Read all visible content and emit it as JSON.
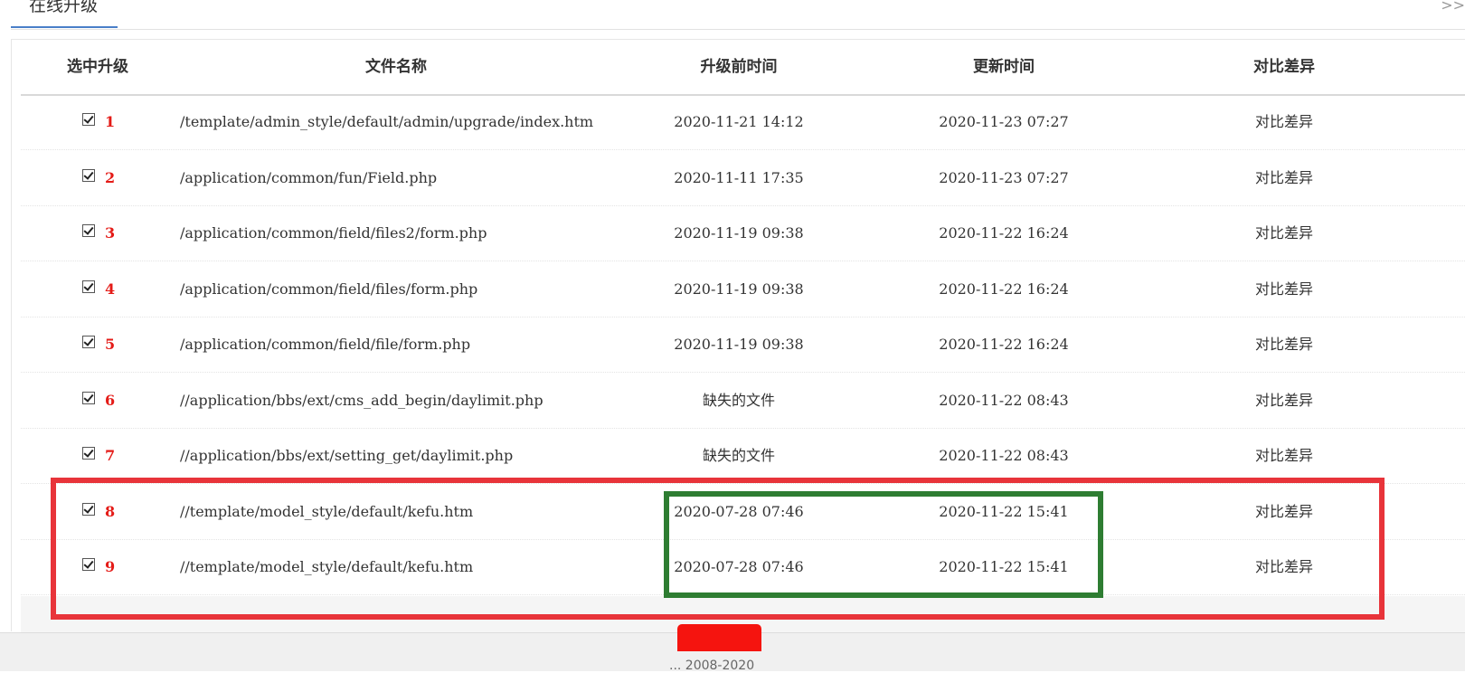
{
  "tab": {
    "title": "在线升级",
    "more": ">>"
  },
  "table": {
    "headers": {
      "select": "选中升级",
      "filename": "文件名称",
      "before_time": "升级前时间",
      "update_time": "更新时间",
      "diff": "对比差异"
    },
    "rows": [
      {
        "num": "1",
        "checked": true,
        "file": "/template/admin_style/default/admin/upgrade/index.htm",
        "before": "2020-11-21 14:12",
        "update": "2020-11-23 07:27",
        "diff": "对比差异"
      },
      {
        "num": "2",
        "checked": true,
        "file": "/application/common/fun/Field.php",
        "before": "2020-11-11 17:35",
        "update": "2020-11-23 07:27",
        "diff": "对比差异"
      },
      {
        "num": "3",
        "checked": true,
        "file": "/application/common/field/files2/form.php",
        "before": "2020-11-19 09:38",
        "update": "2020-11-22 16:24",
        "diff": "对比差异"
      },
      {
        "num": "4",
        "checked": true,
        "file": "/application/common/field/files/form.php",
        "before": "2020-11-19 09:38",
        "update": "2020-11-22 16:24",
        "diff": "对比差异"
      },
      {
        "num": "5",
        "checked": true,
        "file": "/application/common/field/file/form.php",
        "before": "2020-11-19 09:38",
        "update": "2020-11-22 16:24",
        "diff": "对比差异"
      },
      {
        "num": "6",
        "checked": true,
        "file": "//application/bbs/ext/cms_add_begin/daylimit.php",
        "before": "缺失的文件",
        "update": "2020-11-22 08:43",
        "diff": "对比差异"
      },
      {
        "num": "7",
        "checked": true,
        "file": "//application/bbs/ext/setting_get/daylimit.php",
        "before": "缺失的文件",
        "update": "2020-11-22 08:43",
        "diff": "对比差异"
      },
      {
        "num": "8",
        "checked": true,
        "file": "//template/model_style/default/kefu.htm",
        "before": "2020-07-28 07:46",
        "update": "2020-11-22 15:41",
        "diff": "对比差异"
      },
      {
        "num": "9",
        "checked": true,
        "file": "//template/model_style/default/kefu.htm",
        "before": "2020-07-28 07:46",
        "update": "2020-11-22 15:41",
        "diff": "对比差异"
      }
    ]
  },
  "footer": {
    "text": "... 2008-2020"
  },
  "colors": {
    "row_number": "#e41b17",
    "tab_underline": "#4a7fc8",
    "submit_button": "#f5140f",
    "highlight_red": "#e8343a",
    "highlight_green": "#2e7d32"
  }
}
